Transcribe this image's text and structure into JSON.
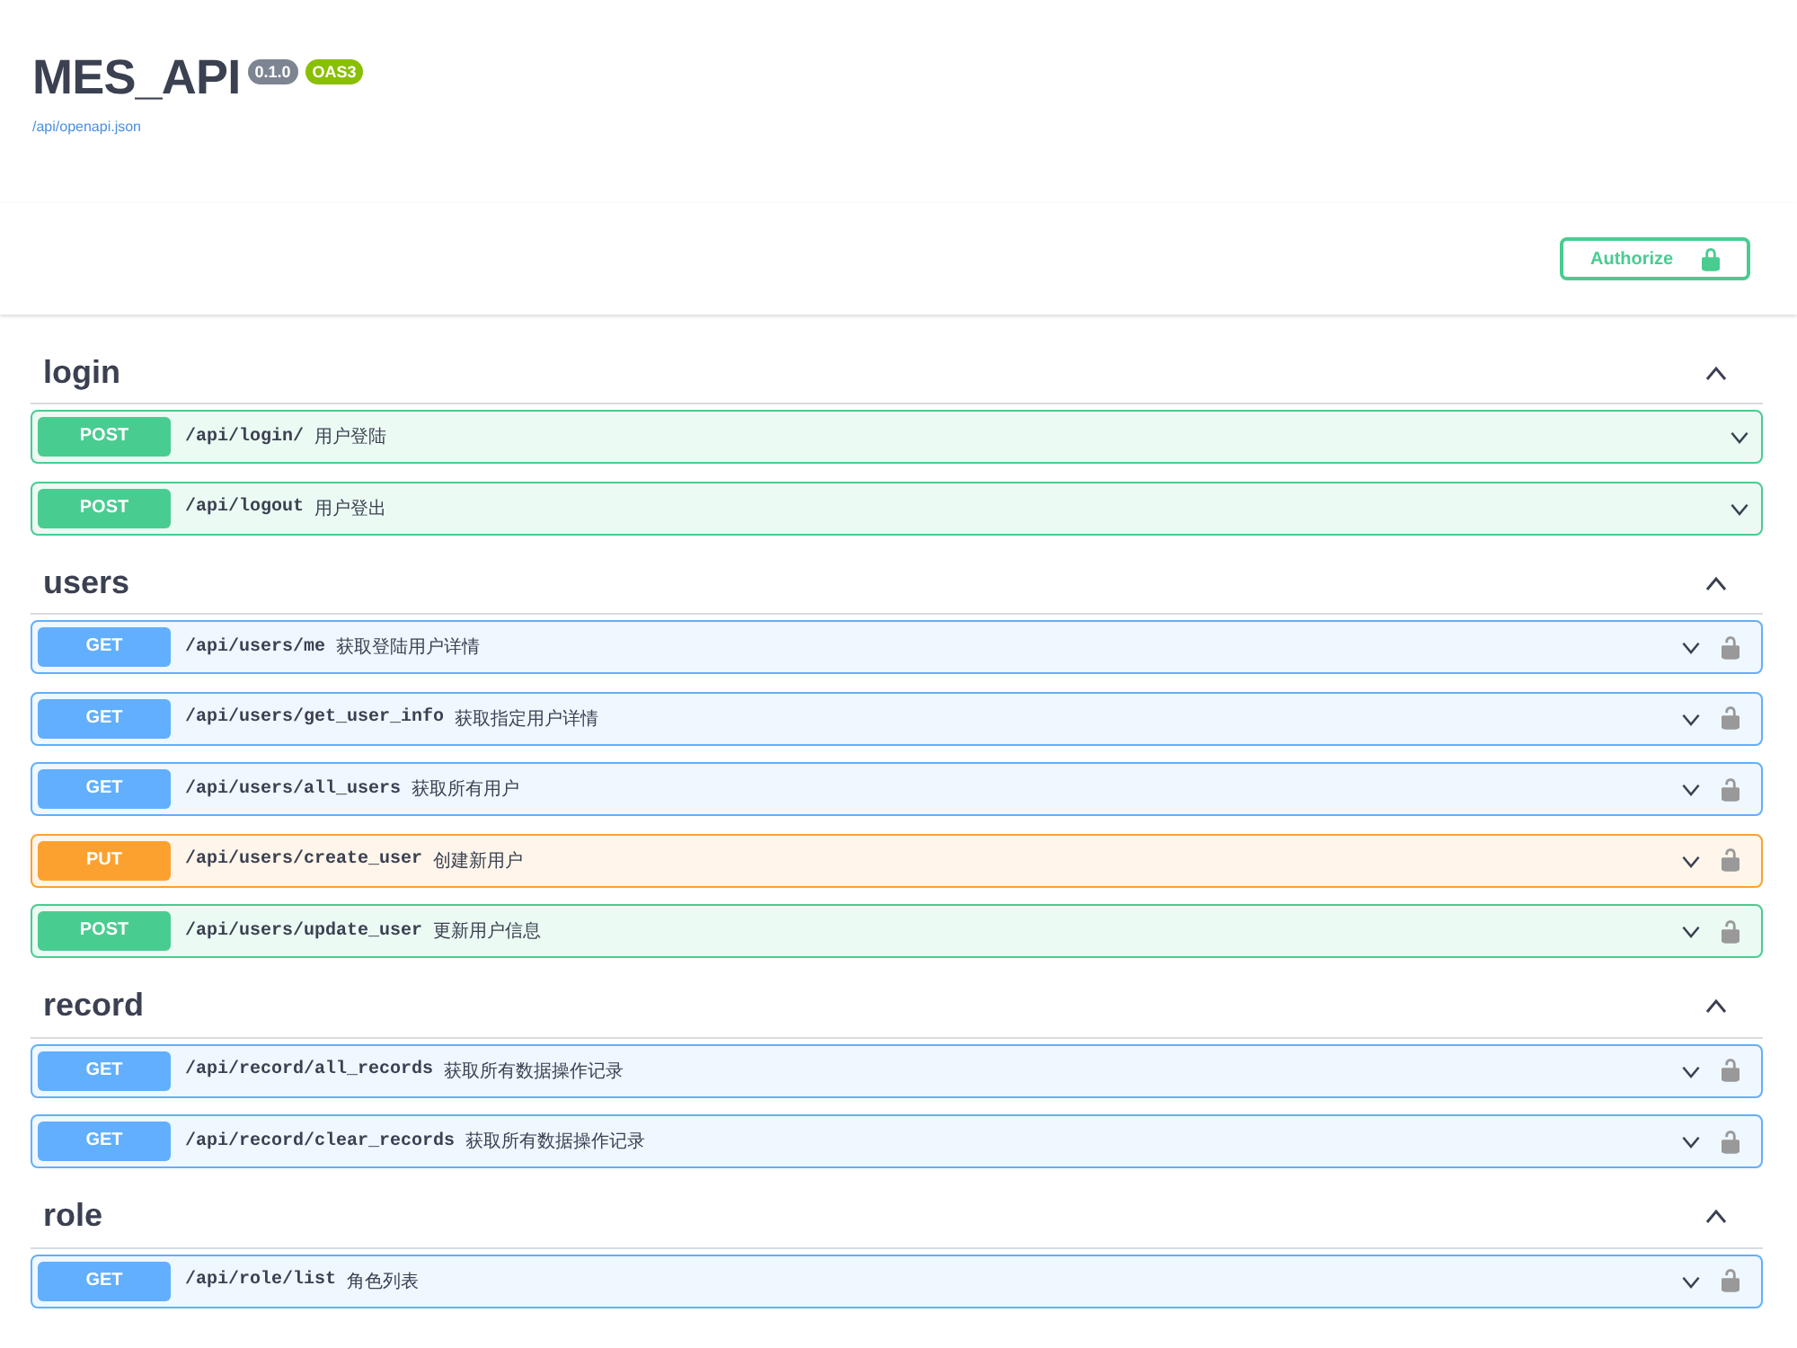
{
  "info": {
    "title": "MES_API",
    "version": "0.1.0",
    "spec_badge": "OAS3",
    "spec_link": "/api/openapi.json"
  },
  "authorize": {
    "label": "Authorize"
  },
  "sections": [
    {
      "name": "login",
      "expanded": true,
      "operations": [
        {
          "kind": "post",
          "method": "POST",
          "path": "/api/login/",
          "summary": "用户登陆",
          "secured": false
        },
        {
          "kind": "post",
          "method": "POST",
          "path": "/api/logout",
          "summary": "用户登出",
          "secured": false
        }
      ]
    },
    {
      "name": "users",
      "expanded": true,
      "operations": [
        {
          "kind": "get",
          "method": "GET",
          "path": "/api/users/me",
          "summary": "获取登陆用户详情",
          "secured": true
        },
        {
          "kind": "get",
          "method": "GET",
          "path": "/api/users/get_user_info",
          "summary": "获取指定用户详情",
          "secured": true
        },
        {
          "kind": "get",
          "method": "GET",
          "path": "/api/users/all_users",
          "summary": "获取所有用户",
          "secured": true
        },
        {
          "kind": "put",
          "method": "PUT",
          "path": "/api/users/create_user",
          "summary": "创建新用户",
          "secured": true
        },
        {
          "kind": "post",
          "method": "POST",
          "path": "/api/users/update_user",
          "summary": "更新用户信息",
          "secured": true
        }
      ]
    },
    {
      "name": "record",
      "expanded": true,
      "operations": [
        {
          "kind": "get",
          "method": "GET",
          "path": "/api/record/all_records",
          "summary": "获取所有数据操作记录",
          "secured": true
        },
        {
          "kind": "get",
          "method": "GET",
          "path": "/api/record/clear_records",
          "summary": "获取所有数据操作记录",
          "secured": true
        }
      ]
    },
    {
      "name": "role",
      "expanded": true,
      "operations": [
        {
          "kind": "get",
          "method": "GET",
          "path": "/api/role/list",
          "summary": "角色列表",
          "secured": true
        }
      ]
    }
  ]
}
